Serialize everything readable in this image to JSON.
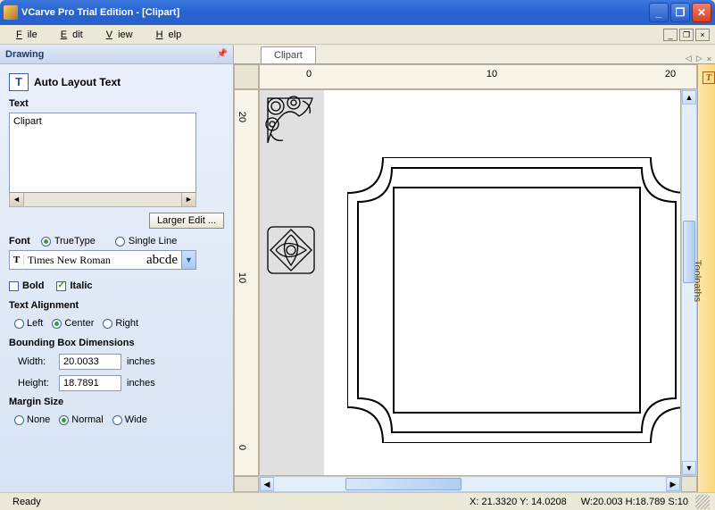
{
  "window": {
    "title": "VCarve Pro Trial Edition - [Clipart]"
  },
  "menu": {
    "file": "File",
    "edit": "Edit",
    "view": "View",
    "help": "Help"
  },
  "panel": {
    "title": "Drawing",
    "section": "Auto Layout Text",
    "text_label": "Text",
    "text_value": "Clipart",
    "larger_edit": "Larger Edit ...",
    "font_label": "Font",
    "truetype": "TrueType",
    "singleline": "Single Line",
    "font_name": "Times New Roman",
    "font_preview": "abcde",
    "bold": "Bold",
    "italic": "Italic",
    "alignment_label": "Text Alignment",
    "align_left": "Left",
    "align_center": "Center",
    "align_right": "Right",
    "bbox_label": "Bounding Box Dimensions",
    "width_label": "Width:",
    "width_value": "20.0033",
    "height_label": "Height:",
    "height_value": "18.7891",
    "units": "inches",
    "margin_label": "Margin Size",
    "margin_none": "None",
    "margin_normal": "Normal",
    "margin_wide": "Wide"
  },
  "tab": {
    "name": "Clipart"
  },
  "ruler": {
    "t0": "0",
    "t10": "10",
    "t20": "20"
  },
  "sidetab": {
    "label": "Toolpaths",
    "icon": "T"
  },
  "status": {
    "ready": "Ready",
    "coords": "X: 21.3320 Y: 14.0208",
    "dims": "W:20.003  H:18.789  S:10"
  }
}
